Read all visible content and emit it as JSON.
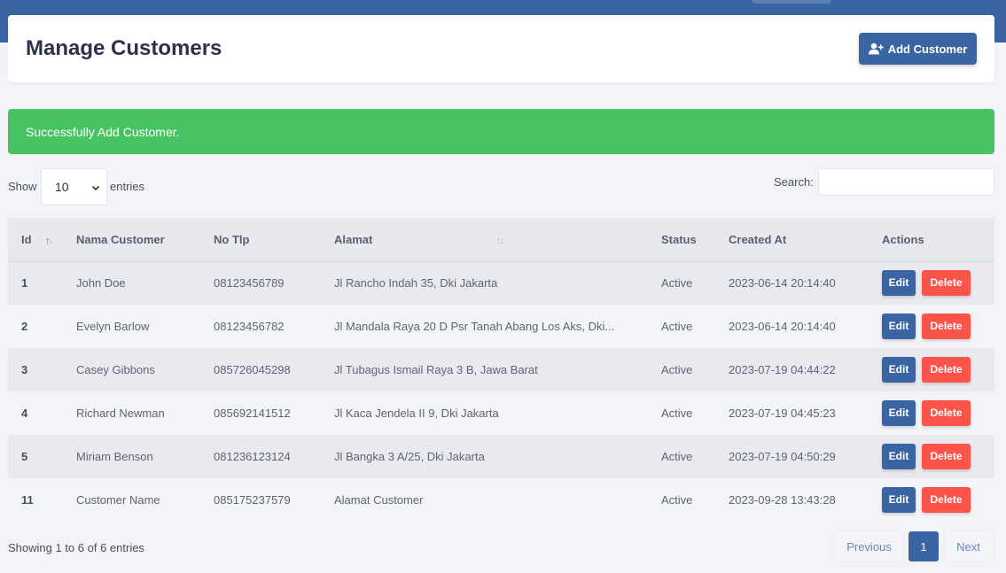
{
  "header": {
    "title": "Manage Customers",
    "add_label": "Add Customer"
  },
  "alert": {
    "message": "Successfully Add Customer."
  },
  "controls": {
    "show_label": "Show",
    "length_value": "10",
    "entries_label": "entries",
    "search_label": "Search:",
    "search_value": ""
  },
  "table": {
    "columns": [
      "Id",
      "Nama Customer",
      "No Tlp",
      "Alamat",
      "Status",
      "Created At",
      "Actions"
    ],
    "rows": [
      {
        "id": "1",
        "name": "John Doe",
        "phone": "08123456789",
        "address": "Jl Rancho Indah 35, Dki Jakarta",
        "status": "Active",
        "created": "2023-06-14 20:14:40"
      },
      {
        "id": "2",
        "name": "Evelyn Barlow",
        "phone": "08123456782",
        "address": "Jl Mandala Raya 20 D Psr Tanah Abang Los Aks, Dki...",
        "status": "Active",
        "created": "2023-06-14 20:14:40"
      },
      {
        "id": "3",
        "name": "Casey Gibbons",
        "phone": "085726045298",
        "address": "Jl Tubagus Ismail Raya 3 B, Jawa Barat",
        "status": "Active",
        "created": "2023-07-19 04:44:22"
      },
      {
        "id": "4",
        "name": "Richard Newman",
        "phone": "085692141512",
        "address": "Jl Kaca Jendela II 9, Dki Jakarta",
        "status": "Active",
        "created": "2023-07-19 04:45:23"
      },
      {
        "id": "5",
        "name": "Miriam Benson",
        "phone": "081236123124",
        "address": "Jl Bangka 3 A/25, Dki Jakarta",
        "status": "Active",
        "created": "2023-07-19 04:50:29"
      },
      {
        "id": "11",
        "name": "Customer Name",
        "phone": "085175237579",
        "address": "Alamat Customer",
        "status": "Active",
        "created": "2023-09-28 13:43:28"
      }
    ],
    "edit_label": "Edit",
    "delete_label": "Delete"
  },
  "footer": {
    "info": "Showing 1 to 6 of 6 entries",
    "prev_label": "Previous",
    "page_label": "1",
    "next_label": "Next"
  },
  "colors": {
    "primary": "#3b64a3",
    "success": "#47c363",
    "danger": "#fc544b"
  }
}
